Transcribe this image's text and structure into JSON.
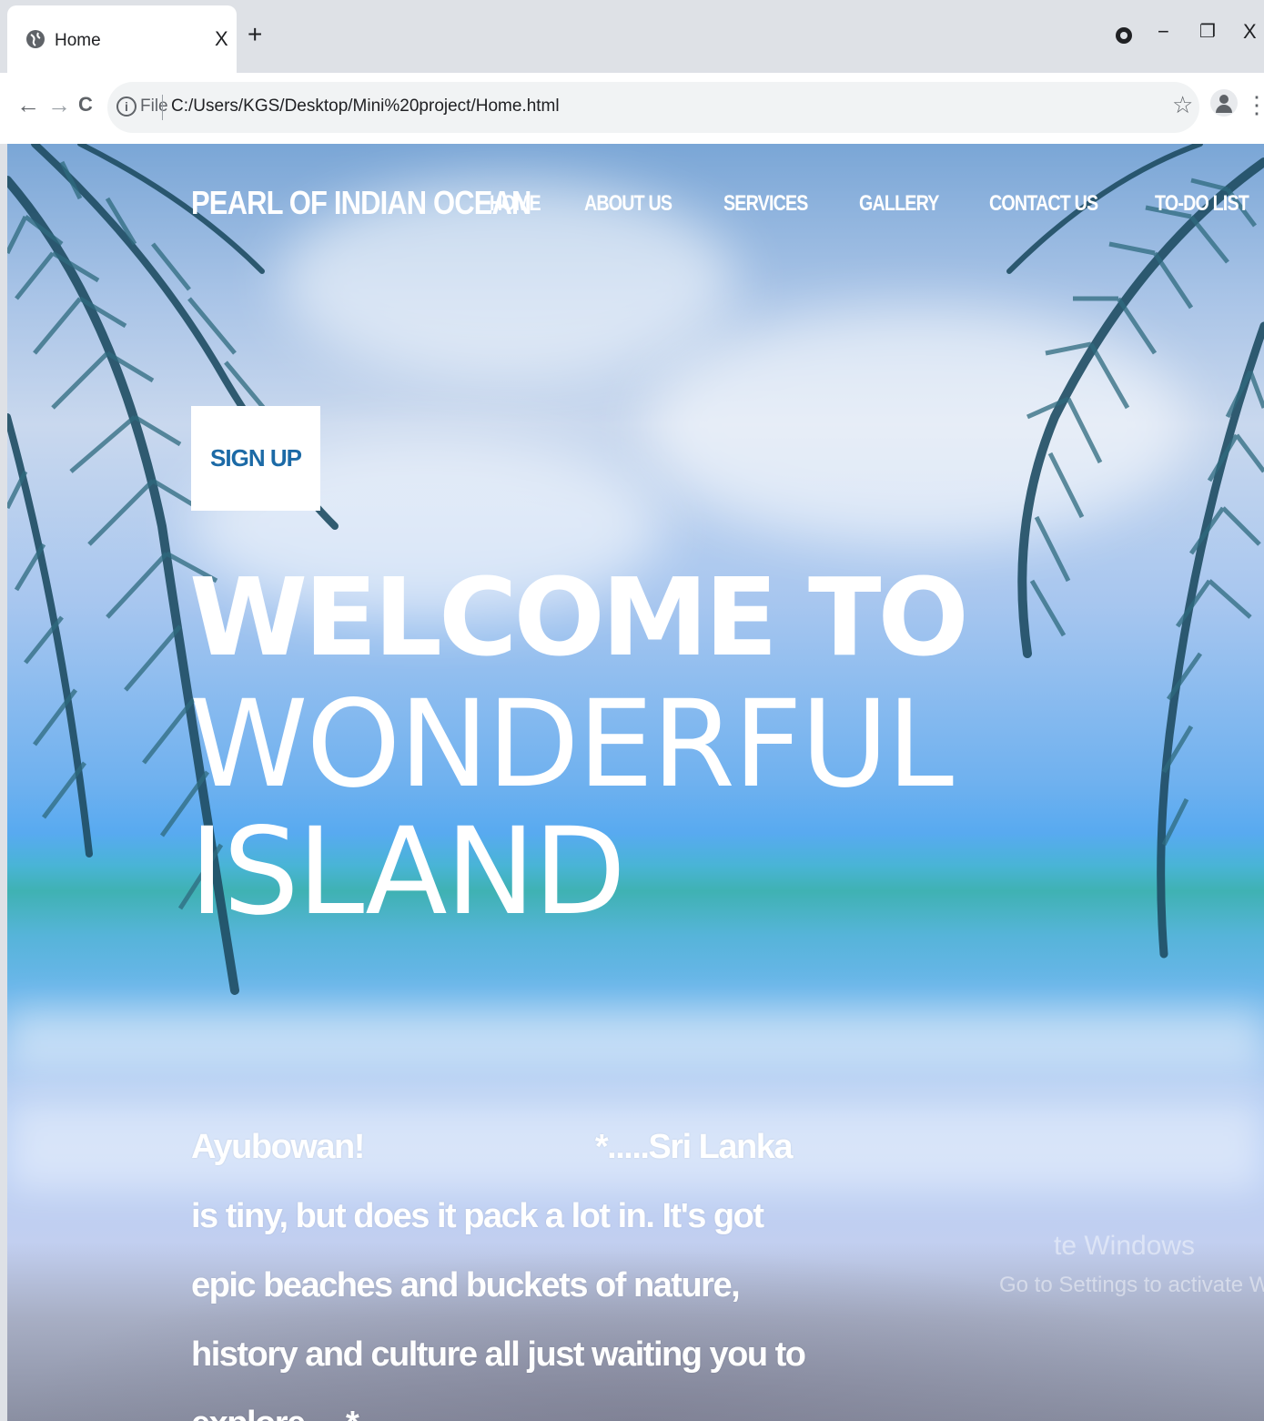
{
  "browser": {
    "tab_title": "Home",
    "tab_close": "X",
    "new_tab": "+",
    "minimize": "−",
    "restore": "❐",
    "close": "X",
    "back": "←",
    "forward": "→",
    "reload": "C",
    "info": "i",
    "file_label": "File",
    "url": "C:/Users/KGS/Desktop/Mini%20project/Home.html",
    "star": "☆",
    "menu": "⋮"
  },
  "site": {
    "brand": "PEARL OF INDIAN OCEAN",
    "nav": [
      "HOME",
      "ABOUT US",
      "SERVICES",
      "GALLERY",
      "CONTACT US",
      "TO-DO LIST"
    ],
    "signup_label": "SIGN UP",
    "hero": [
      "WELCOME TO",
      "WONDERFUL",
      "ISLAND"
    ],
    "intro_greeting": "Ayubowan!",
    "intro_first": "*.....Sri Lanka is tiny,",
    "intro_rest": "but does it pack a lot in. It's got epic beaches and buckets of nature, history and culture all just waiting you to explore.....*"
  },
  "watermark": {
    "line1": "te Windows",
    "line2": "Go to Settings to activate Windows."
  },
  "colors": {
    "signup_text": "#1c6aa6",
    "chrome_bg": "#dee1e6"
  }
}
